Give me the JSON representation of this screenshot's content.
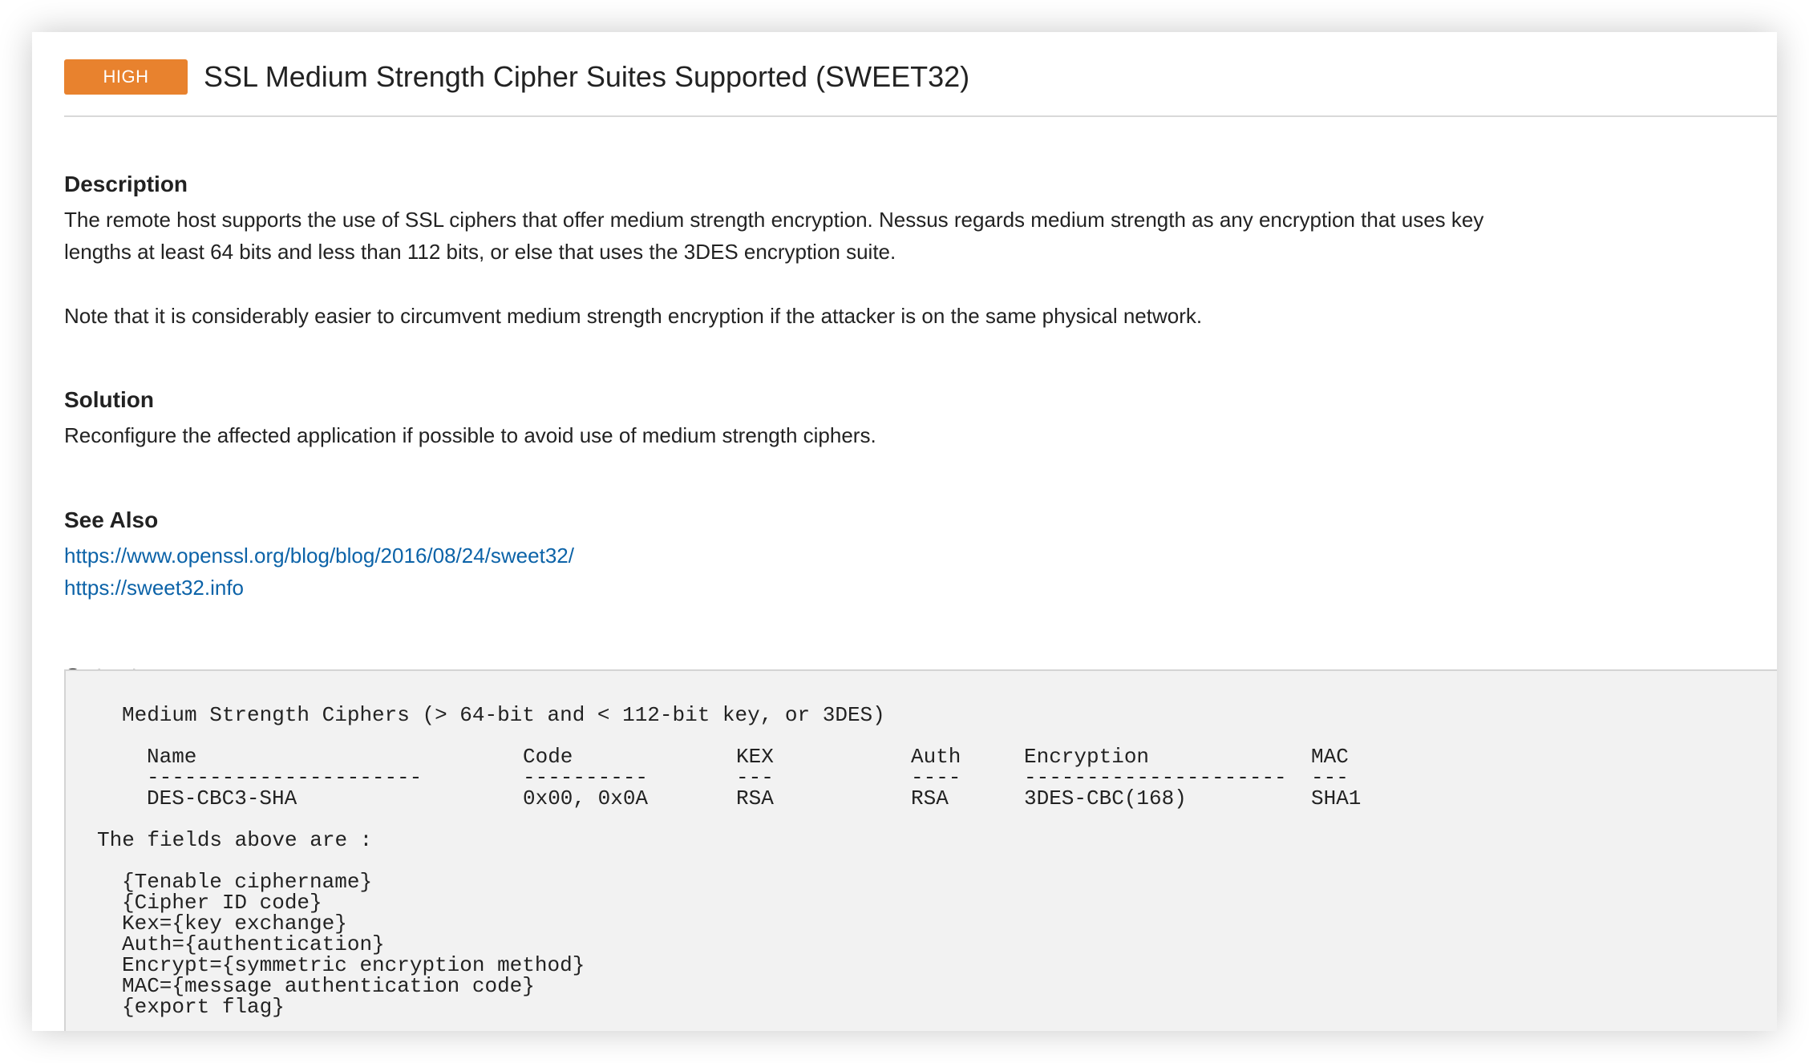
{
  "finding": {
    "severity": "HIGH",
    "severity_color": "#e8822e",
    "title": "SSL Medium Strength Cipher Suites Supported (SWEET32)"
  },
  "description": {
    "heading": "Description",
    "line1": "The remote host supports the use of SSL ciphers that offer medium strength encryption. Nessus regards medium strength as any encryption that uses key",
    "line2": "lengths at least 64 bits and less than 112 bits, or else that uses the 3DES encryption suite.",
    "line3": "Note that it is considerably easier to circumvent medium strength encryption if the attacker is on the same physical network."
  },
  "solution": {
    "heading": "Solution",
    "text": "Reconfigure the affected application if possible to avoid use of medium strength ciphers."
  },
  "see_also": {
    "heading": "See Also",
    "links": [
      "https://www.openssl.org/blog/blog/2016/08/24/sweet32/",
      "https://sweet32.info"
    ]
  },
  "output": {
    "heading": "Output",
    "summary": "Medium Strength Ciphers (> 64-bit and < 112-bit key, or 3DES)",
    "columns": [
      "Name",
      "Code",
      "KEX",
      "Auth",
      "Encryption",
      "MAC"
    ],
    "separators": [
      "----------------------",
      "----------",
      "---",
      "----",
      "---------------------",
      "---"
    ],
    "rows": [
      [
        "DES-CBC3-SHA",
        "0x00, 0x0A",
        "RSA",
        "RSA",
        "3DES-CBC(168)",
        "SHA1"
      ]
    ],
    "fields_intro": "The fields above are :",
    "fields": [
      "{Tenable ciphername}",
      "{Cipher ID code}",
      "Kex={key exchange}",
      "Auth={authentication}",
      "Encrypt={symmetric encryption method}",
      "MAC={message authentication code}",
      "{export flag}"
    ]
  }
}
